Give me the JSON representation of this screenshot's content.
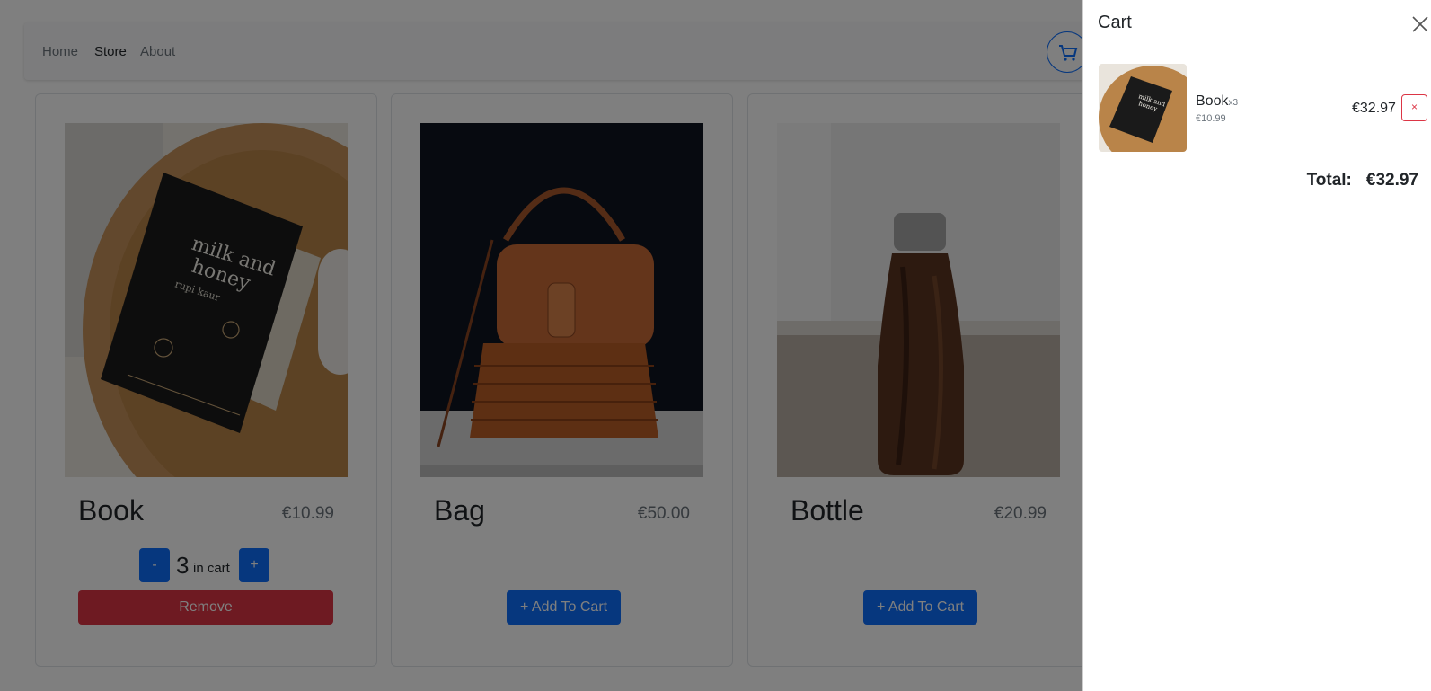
{
  "nav": {
    "items": [
      {
        "label": "Home",
        "active": false
      },
      {
        "label": "Store",
        "active": true
      },
      {
        "label": "About",
        "active": false
      }
    ]
  },
  "products": [
    {
      "name": "Book",
      "price": "€10.99",
      "quantity": "3",
      "in_cart_label": "in cart",
      "minus_label": "-",
      "plus_label": "+",
      "remove_label": "Remove"
    },
    {
      "name": "Bag",
      "price": "€50.00",
      "add_label": "+ Add To Cart"
    },
    {
      "name": "Bottle",
      "price": "€20.99",
      "add_label": "+ Add To Cart"
    }
  ],
  "cart": {
    "title": "Cart",
    "items": [
      {
        "name": "Book",
        "qty_label": "x3",
        "unit_price": "€10.99",
        "line_total": "€32.97",
        "remove_label": "×"
      }
    ],
    "total_label": "Total:",
    "total_value": "€32.97"
  },
  "colors": {
    "primary": "#0d6efd",
    "danger": "#dc3545",
    "backdrop": "rgba(0,0,0,0.5)"
  }
}
